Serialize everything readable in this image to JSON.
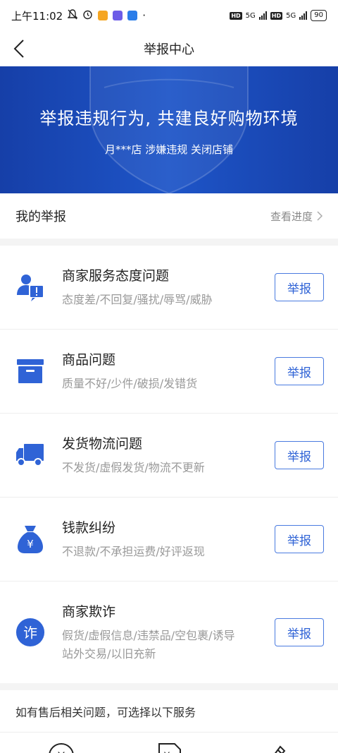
{
  "status_bar": {
    "time": "上午11:02",
    "hd1": "HD",
    "net1": "5G",
    "hd2": "HD",
    "net2": "5G",
    "battery": "90",
    "app_colors": [
      "#f5a623",
      "#6c5ce7",
      "#2b7de9"
    ]
  },
  "nav": {
    "title": "举报中心"
  },
  "banner": {
    "title": "举报违规行为, 共建良好购物环境",
    "subtitle": "月***店 涉嫌违规 关闭店铺",
    "bg_color": "#1a4bb8"
  },
  "my_report": {
    "title": "我的举报",
    "link": "查看进度"
  },
  "categories": [
    {
      "title": "商家服务态度问题",
      "desc": "态度差/不回复/骚扰/辱骂/威胁",
      "button": "举报",
      "icon": "customer-service-icon"
    },
    {
      "title": "商品问题",
      "desc": "质量不好/少件/破损/发错货",
      "button": "举报",
      "icon": "box-icon"
    },
    {
      "title": "发货物流问题",
      "desc": "不发货/虚假发货/物流不更新",
      "button": "举报",
      "icon": "truck-icon"
    },
    {
      "title": "钱款纠纷",
      "desc": "不退款/不承担运费/好评返现",
      "button": "举报",
      "icon": "money-bag-icon"
    },
    {
      "title": "商家欺诈",
      "desc1": "假货/虚假信息/违禁品/空包裹/诱导",
      "desc2": "站外交易/以旧充新",
      "button": "举报",
      "icon": "fraud-icon",
      "icon_text": "诈"
    }
  ],
  "after_sale": {
    "text": "如有售后相关问题，可选择以下服务"
  },
  "accent_color": "#2f63d6"
}
